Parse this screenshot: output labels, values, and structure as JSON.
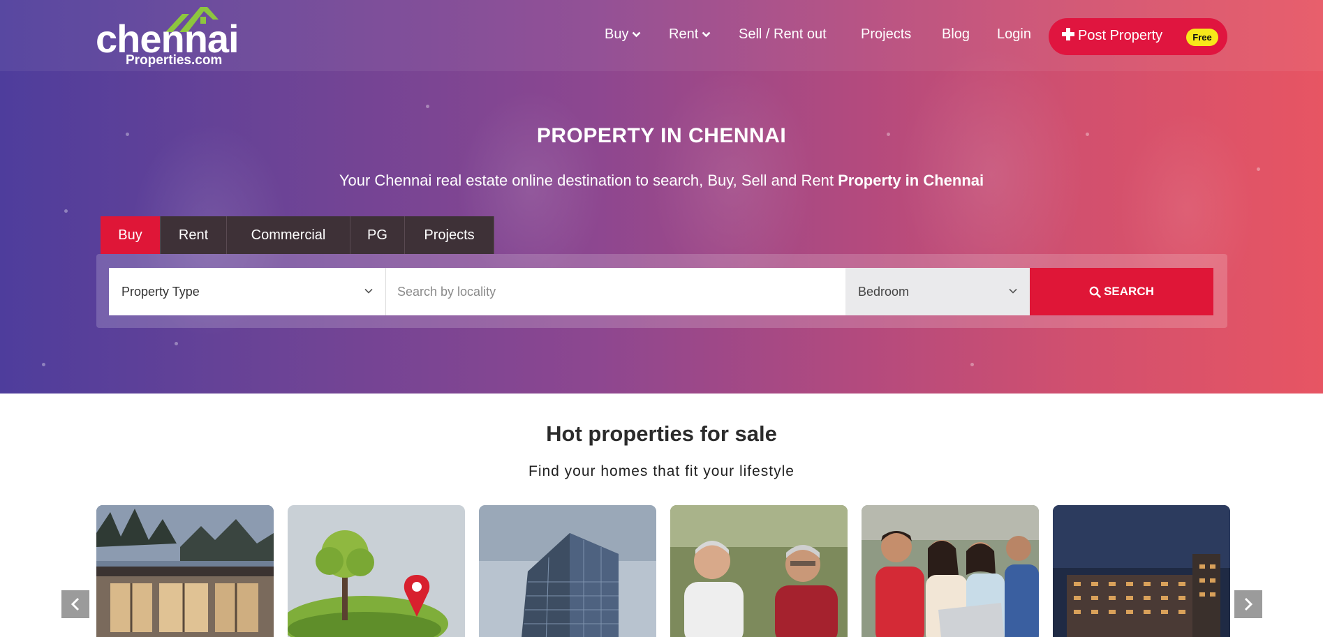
{
  "logo": {
    "main": "chennai",
    "sub": "Properties.com"
  },
  "nav": {
    "items": [
      {
        "label": "Buy",
        "dropdown": true
      },
      {
        "label": "Rent",
        "dropdown": true
      },
      {
        "label": "Sell / Rent out",
        "dropdown": false
      },
      {
        "label": "Projects",
        "dropdown": false
      },
      {
        "label": "Blog",
        "dropdown": false
      },
      {
        "label": "Login",
        "dropdown": false
      }
    ],
    "post_button": {
      "label": "Post Property",
      "badge": "Free",
      "icon": "plus-icon"
    }
  },
  "hero": {
    "title": "PROPERTY IN CHENNAI",
    "subtitle_plain": "Your Chennai real estate online destination to search, Buy, Sell and Rent ",
    "subtitle_bold": "Property in Chennai"
  },
  "search": {
    "tabs": [
      {
        "label": "Buy",
        "active": true
      },
      {
        "label": "Rent",
        "active": false
      },
      {
        "label": "Commercial",
        "active": false
      },
      {
        "label": "PG",
        "active": false
      },
      {
        "label": "Projects",
        "active": false
      }
    ],
    "property_type": "Property Type",
    "locality_placeholder": "Search by locality",
    "bedroom": "Bedroom",
    "button_label": "SEARCH"
  },
  "hot": {
    "title": "Hot properties for sale",
    "subtitle": "Find your homes that fit your lifestyle",
    "cards": [
      "house-photo",
      "land-plot-photo",
      "office-building-photo",
      "senior-couple-photo",
      "students-laptop-photo",
      "apartment-tower-photo"
    ]
  },
  "colors": {
    "accent_red": "#df1637",
    "badge_yellow": "#f7e81a",
    "tab_dark": "#3e3137",
    "logo_green": "#8dc63f"
  }
}
